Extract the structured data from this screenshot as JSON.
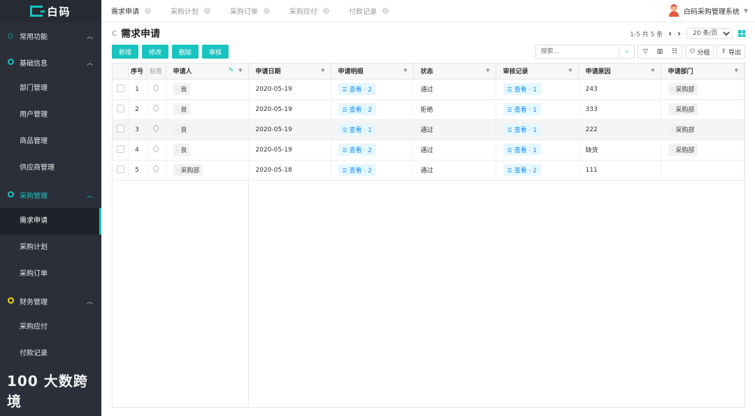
{
  "brand": {
    "name": "白码",
    "accent": "#17c4c0"
  },
  "sidebar": {
    "groups": [
      {
        "label": "常用功能",
        "icon": "star-icon",
        "items": []
      },
      {
        "label": "基础信息",
        "icon": "circle-icon",
        "items": [
          "部门管理",
          "用户管理",
          "商品管理",
          "供应商管理"
        ]
      },
      {
        "label": "采购管理",
        "icon": "circle-icon",
        "items": [
          "需求申请",
          "采购计划",
          "采购订单"
        ]
      },
      {
        "label": "财务管理",
        "icon": "circle-icon",
        "items": [
          "采购应付",
          "付款记录"
        ]
      }
    ],
    "watermark": "100 大数跨境"
  },
  "tabs": [
    "需求申请",
    "采购计划",
    "采购订单",
    "采购应付",
    "付款记录"
  ],
  "user": {
    "name": "白码采购管理系统"
  },
  "page": {
    "title": "需求申请"
  },
  "pager": {
    "info": "1-5 共 5 条",
    "page_size": "20 条/页"
  },
  "actions": {
    "add": "新增",
    "edit": "修改",
    "delete": "删除",
    "review": "审核"
  },
  "tools": {
    "search_placeholder": "搜索...",
    "group": "分组",
    "export": "导出"
  },
  "table": {
    "headers": {
      "idx": "序号",
      "tag": "标签",
      "applicant": "申请人",
      "date": "申请日期",
      "detail": "申请明细",
      "status": "状态",
      "review": "审核记录",
      "reason": "申请原因",
      "dept": "申请部门"
    },
    "rows": [
      {
        "idx": "1",
        "applicant": "良",
        "date": "2020-05-19",
        "detail": "查看 · 2",
        "status": "通过",
        "review": "查看 · 1",
        "reason": "243",
        "dept": "采购部"
      },
      {
        "idx": "2",
        "applicant": "良",
        "date": "2020-05-19",
        "detail": "查看 · 2",
        "status": "拒绝",
        "review": "查看 · 1",
        "reason": "333",
        "dept": "采购部"
      },
      {
        "idx": "3",
        "applicant": "良",
        "date": "2020-05-19",
        "detail": "查看 · 1",
        "status": "通过",
        "review": "查看 · 1",
        "reason": "222",
        "dept": "采购部"
      },
      {
        "idx": "4",
        "applicant": "良",
        "date": "2020-05-19",
        "detail": "查看 · 2",
        "status": "通过",
        "review": "查看 · 1",
        "reason": "缺货",
        "dept": "采购部"
      },
      {
        "idx": "5",
        "applicant": "采购部",
        "date": "2020-05-18",
        "detail": "查看 · 2",
        "status": "通过",
        "review": "查看 · 2",
        "reason": "111",
        "dept": ""
      }
    ]
  }
}
